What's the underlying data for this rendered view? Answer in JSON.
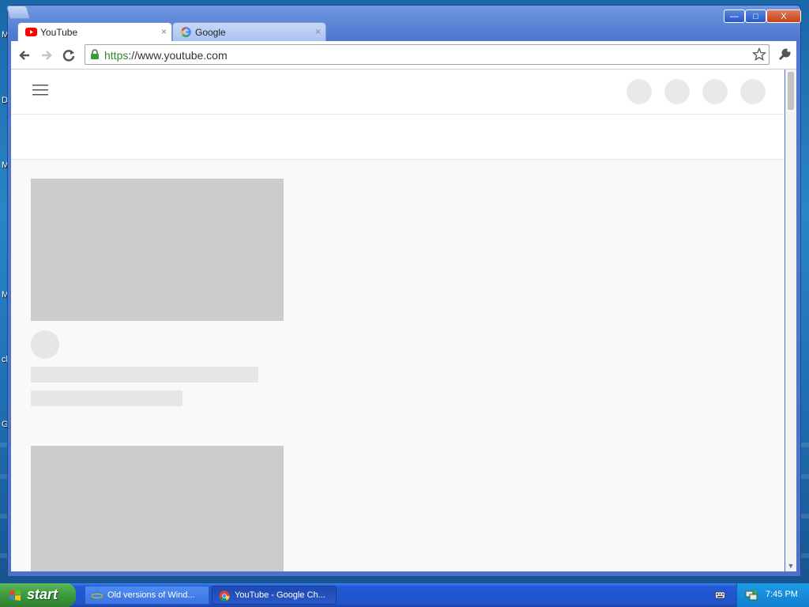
{
  "window": {
    "controls": {
      "minimize": "—",
      "maximize": "□",
      "close": "X"
    }
  },
  "tabs": [
    {
      "label": "YouTube",
      "icon": "youtube-icon",
      "close": "×"
    },
    {
      "label": "Google",
      "icon": "google-icon",
      "close": "×"
    }
  ],
  "toolbar": {
    "url_scheme": "https",
    "url_rest": "://www.youtube.com",
    "back": "back-arrow-icon",
    "forward": "forward-arrow-icon",
    "reload": "reload-icon",
    "bookmark": "star-icon",
    "menu": "wrench-icon"
  },
  "desktop": {
    "letters": [
      "M",
      "D",
      "M",
      "M",
      "cl",
      "G"
    ]
  },
  "taskbar": {
    "start_label": "start",
    "items": [
      {
        "label": "Old versions of Wind...",
        "icon": "ie-icon"
      },
      {
        "label": "YouTube - Google Ch...",
        "icon": "chrome-icon"
      }
    ],
    "clock": "7:45 PM"
  },
  "colors": {
    "accent": "#2053c8",
    "start_green": "#3b9a3c",
    "youtube_red": "#ff0000"
  }
}
